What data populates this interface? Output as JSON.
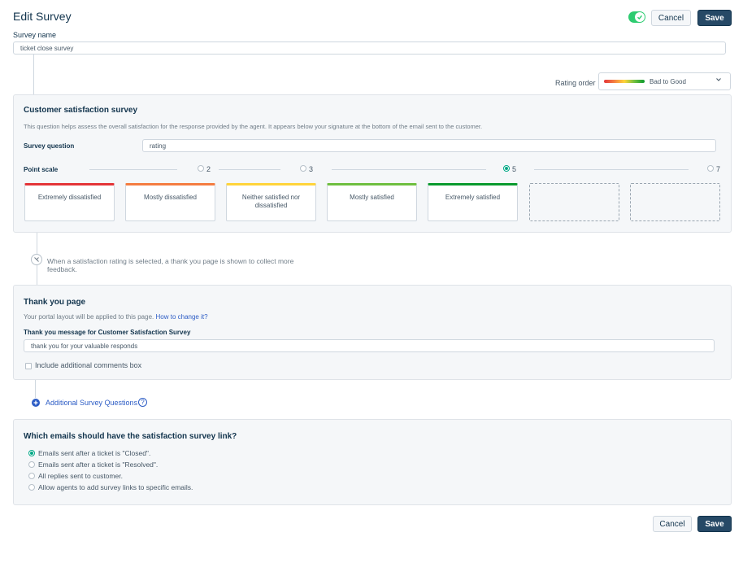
{
  "header": {
    "title": "Edit Survey",
    "cancel_label": "Cancel",
    "save_label": "Save",
    "enabled": true
  },
  "survey_name": {
    "label": "Survey name",
    "value": "ticket close survey"
  },
  "rating_order": {
    "label": "Rating order",
    "value": "Bad to Good"
  },
  "csat": {
    "title": "Customer satisfaction survey",
    "description": "This question helps assess the overall satisfaction for the response provided by the agent. It appears below your signature at the bottom of the email sent to the customer.",
    "question_label": "Survey question",
    "question_value": "rating",
    "point_scale_label": "Point scale",
    "point_options": [
      "2",
      "3",
      "5",
      "7"
    ],
    "selected_points": "5",
    "ratings": [
      {
        "label": "Extremely dissatisfied",
        "color": "#e43538"
      },
      {
        "label": "Mostly dissatisfied",
        "color": "#f47d41"
      },
      {
        "label": "Neither satisfied nor dissatisfied",
        "color": "#ffd43b"
      },
      {
        "label": "Mostly satisfied",
        "color": "#6fbf40"
      },
      {
        "label": "Extremely satisfied",
        "color": "#0a9a2e"
      }
    ]
  },
  "flow_note": {
    "text": "When a satisfaction rating is selected, a thank you page is shown to collect more feedback."
  },
  "thank_you": {
    "title": "Thank you page",
    "layout_note": "Your portal layout will be applied to this page.",
    "layout_link": "How to change it?",
    "message_label": "Thank you message for Customer Satisfaction Survey",
    "message_value": "thank you for your valuable responds",
    "comments_label": "Include additional comments box",
    "comments_checked": false
  },
  "additional": {
    "label": "Additional Survey Questions",
    "help": "?"
  },
  "emails": {
    "title": "Which emails should have the satisfaction survey link?",
    "options": [
      "Emails sent after a ticket is \"Closed\".",
      "Emails sent after a ticket is \"Resolved\".",
      "All replies sent to customer.",
      "Allow agents to add survey links to specific emails."
    ],
    "selected_index": 0
  },
  "footer": {
    "cancel_label": "Cancel",
    "save_label": "Save"
  },
  "colors": {
    "primary": "#264966",
    "accent_green": "#00a886",
    "link": "#2c5cc5"
  }
}
